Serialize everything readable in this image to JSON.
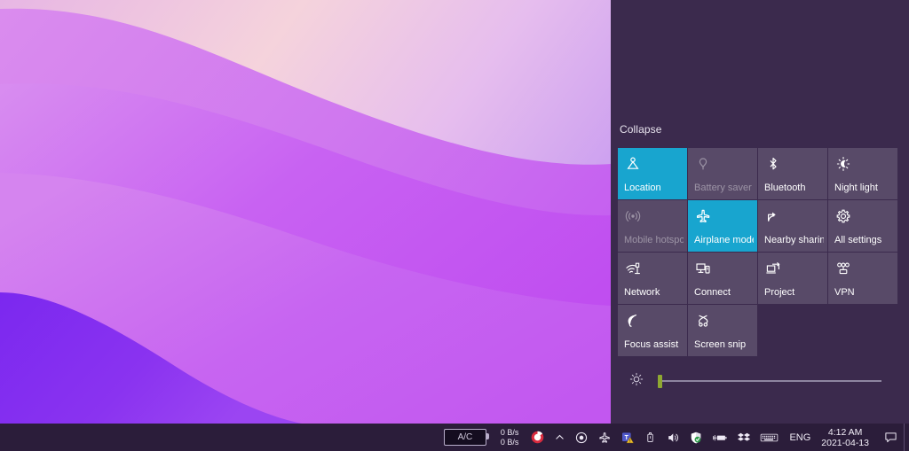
{
  "desktop": {
    "wallpaper_name": "purple-waves-wallpaper",
    "colors": {
      "band_light_pink": "#f2cfe4",
      "band_lavender": "#d9a8ee",
      "band_magenta": "#c05ae8",
      "band_orchid": "#cb6ef0",
      "band_violet": "#8b2ef0",
      "band_deep_violet": "#7a27ee"
    }
  },
  "action_center": {
    "background_color": "#3b2a4d",
    "collapse_label": "Collapse",
    "accent_color": "#18a5cf",
    "tile_color": "#584a68",
    "tiles": [
      {
        "label": "Location",
        "icon": "location-pin-icon",
        "state": "on"
      },
      {
        "label": "Battery saver",
        "icon": "battery-saver-icon",
        "state": "disabled"
      },
      {
        "label": "Bluetooth",
        "icon": "bluetooth-icon",
        "state": "off"
      },
      {
        "label": "Night light",
        "icon": "night-light-icon",
        "state": "off"
      },
      {
        "label": "Mobile hotspot",
        "icon": "mobile-hotspot-icon",
        "state": "disabled"
      },
      {
        "label": "Airplane mode",
        "icon": "airplane-icon",
        "state": "on"
      },
      {
        "label": "Nearby sharing",
        "icon": "nearby-sharing-icon",
        "state": "off"
      },
      {
        "label": "All settings",
        "icon": "gear-icon",
        "state": "off"
      },
      {
        "label": "Network",
        "icon": "network-wifi-icon",
        "state": "off"
      },
      {
        "label": "Connect",
        "icon": "connect-icon",
        "state": "off"
      },
      {
        "label": "Project",
        "icon": "project-icon",
        "state": "off"
      },
      {
        "label": "VPN",
        "icon": "vpn-icon",
        "state": "off"
      },
      {
        "label": "Focus assist",
        "icon": "moon-icon",
        "state": "off"
      },
      {
        "label": "Screen snip",
        "icon": "screen-snip-icon",
        "state": "off"
      }
    ],
    "brightness": {
      "icon": "brightness-sun-icon",
      "value_percent": 2,
      "thumb_color": "#8fa832"
    }
  },
  "taskbar": {
    "background_color": "#2b1d3a",
    "power_badge_label": "A/C",
    "network_speed": {
      "upload": "0 B/s",
      "download": "0 B/s"
    },
    "tray_icons": [
      "app-circle-icon",
      "show-hidden-icons-chevron",
      "record-circle-icon",
      "airplane-tray-icon",
      "teams-warning-icon",
      "usb-eject-icon",
      "volume-icon",
      "windows-security-shield-icon",
      "battery-plug-icon",
      "dropbox-icon",
      "keyboard-icon"
    ],
    "language": "ENG",
    "clock": {
      "time": "4:12 AM",
      "date": "2021-04-13"
    },
    "notification_icon": "notification-speech-bubble-icon"
  }
}
